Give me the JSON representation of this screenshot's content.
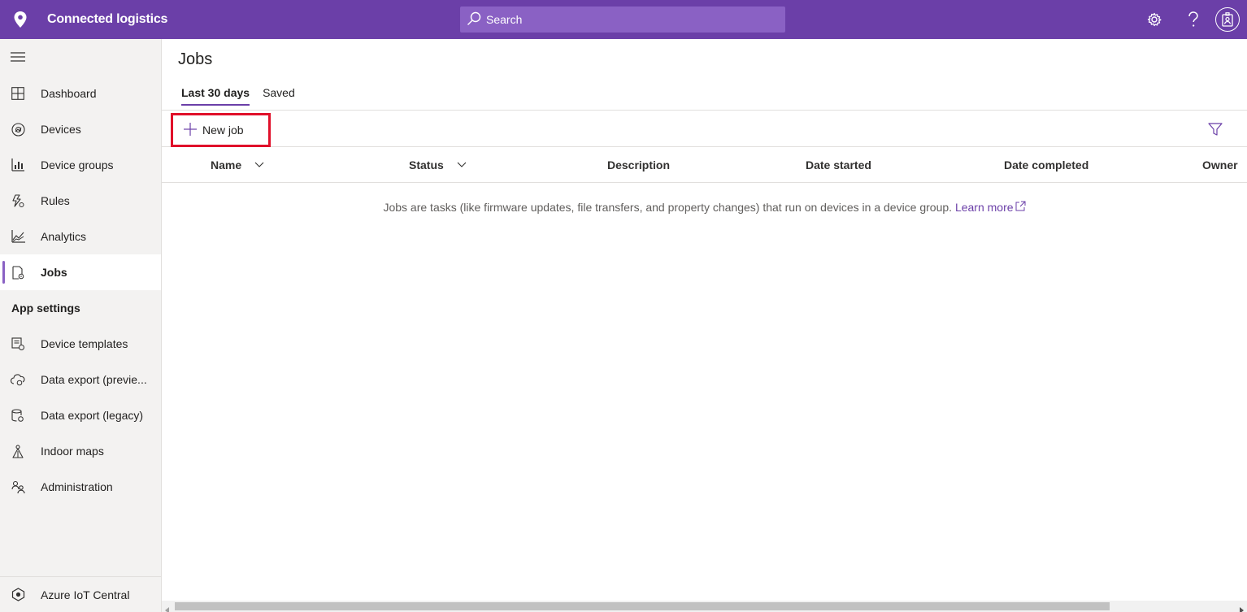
{
  "header": {
    "app_title": "Connected logistics",
    "search_placeholder": "Search",
    "icons": [
      "location-pin-icon",
      "search-icon",
      "gear-icon",
      "help-icon",
      "user-badge-icon"
    ],
    "accent_color": "#6b3fa8"
  },
  "sidebar": {
    "items": [
      {
        "label": "Dashboard",
        "icon": "dashboard-icon"
      },
      {
        "label": "Devices",
        "icon": "devices-icon"
      },
      {
        "label": "Device groups",
        "icon": "device-groups-icon"
      },
      {
        "label": "Rules",
        "icon": "rules-icon"
      },
      {
        "label": "Analytics",
        "icon": "analytics-icon"
      },
      {
        "label": "Jobs",
        "icon": "jobs-icon",
        "active": true
      }
    ],
    "section_label": "App settings",
    "settings_items": [
      {
        "label": "Device templates",
        "icon": "device-templates-icon"
      },
      {
        "label": "Data export (previe...",
        "icon": "cloud-export-icon"
      },
      {
        "label": "Data export (legacy)",
        "icon": "database-export-icon"
      },
      {
        "label": "Indoor maps",
        "icon": "indoor-maps-icon"
      },
      {
        "label": "Administration",
        "icon": "administration-icon"
      }
    ],
    "footer": {
      "label": "Azure IoT Central",
      "icon": "iot-central-icon"
    }
  },
  "main": {
    "page_title": "Jobs",
    "tabs": [
      {
        "label": "Last 30 days",
        "active": true
      },
      {
        "label": "Saved",
        "active": false
      }
    ],
    "toolbar": {
      "new_job_label": "New job",
      "filter_icon": "filter-icon"
    },
    "table": {
      "columns": [
        "Name",
        "Status",
        "Description",
        "Date started",
        "Date completed",
        "Owner"
      ]
    },
    "empty_message": "Jobs are tasks (like firmware updates, file transfers, and property changes) that run on devices in a device group.",
    "learn_more_label": "Learn more"
  }
}
